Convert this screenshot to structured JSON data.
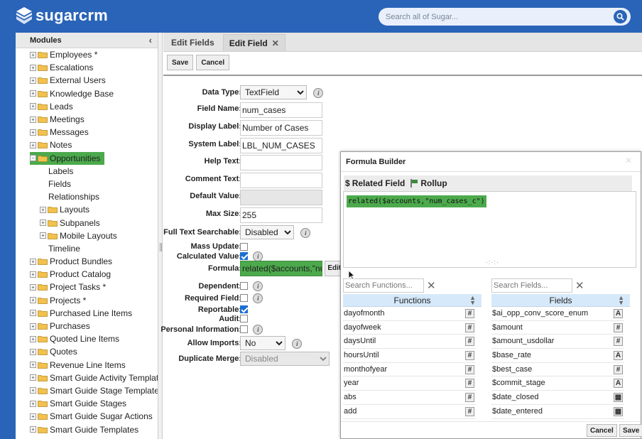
{
  "header": {
    "logo_text": "sugarcrm",
    "search_placeholder": "Search all of Sugar..."
  },
  "sidebar": {
    "title": "Modules",
    "items": [
      {
        "label": "Employees *",
        "level": 0,
        "expander": "+"
      },
      {
        "label": "Escalations",
        "level": 0,
        "expander": "+"
      },
      {
        "label": "External Users",
        "level": 0,
        "expander": "+"
      },
      {
        "label": "Knowledge Base",
        "level": 0,
        "expander": "+"
      },
      {
        "label": "Leads",
        "level": 0,
        "expander": "+"
      },
      {
        "label": "Meetings",
        "level": 0,
        "expander": "+"
      },
      {
        "label": "Messages",
        "level": 0,
        "expander": "+"
      },
      {
        "label": "Notes",
        "level": 0,
        "expander": "+"
      },
      {
        "label": "Opportunities",
        "level": 0,
        "expander": "−",
        "selected": true
      },
      {
        "label": "Labels",
        "level": 1
      },
      {
        "label": "Fields",
        "level": 1
      },
      {
        "label": "Relationships",
        "level": 1
      },
      {
        "label": "Layouts",
        "level": 1,
        "expander": "+",
        "folder": true
      },
      {
        "label": "Subpanels",
        "level": 1,
        "expander": "+",
        "folder": true
      },
      {
        "label": "Mobile Layouts",
        "level": 1,
        "expander": "+",
        "folder": true
      },
      {
        "label": "Timeline",
        "level": 1
      },
      {
        "label": "Product Bundles",
        "level": 0,
        "expander": "+"
      },
      {
        "label": "Product Catalog",
        "level": 0,
        "expander": "+"
      },
      {
        "label": "Project Tasks *",
        "level": 0,
        "expander": "+"
      },
      {
        "label": "Projects *",
        "level": 0,
        "expander": "+"
      },
      {
        "label": "Purchased Line Items",
        "level": 0,
        "expander": "+"
      },
      {
        "label": "Purchases",
        "level": 0,
        "expander": "+"
      },
      {
        "label": "Quoted Line Items",
        "level": 0,
        "expander": "+"
      },
      {
        "label": "Quotes",
        "level": 0,
        "expander": "+"
      },
      {
        "label": "Revenue Line Items",
        "level": 0,
        "expander": "+"
      },
      {
        "label": "Smart Guide Activity Templates",
        "level": 0,
        "expander": "+"
      },
      {
        "label": "Smart Guide Stage Templates",
        "level": 0,
        "expander": "+"
      },
      {
        "label": "Smart Guide Stages",
        "level": 0,
        "expander": "+"
      },
      {
        "label": "Smart Guide Sugar Actions",
        "level": 0,
        "expander": "+"
      },
      {
        "label": "Smart Guide Templates",
        "level": 0,
        "expander": "+"
      }
    ]
  },
  "tabs": {
    "edit_fields": "Edit Fields",
    "edit_field": "Edit Field",
    "close": "✕"
  },
  "toolbar": {
    "save": "Save",
    "cancel": "Cancel"
  },
  "form": {
    "data_type_label": "Data Type:",
    "data_type_value": "TextField",
    "field_name_label": "Field Name:",
    "field_name_value": "num_cases",
    "display_label_label": "Display Label:",
    "display_label_value": "Number of Cases",
    "system_label_label": "System Label:",
    "system_label_value": "LBL_NUM_CASES",
    "help_text_label": "Help Text:",
    "comment_text_label": "Comment Text:",
    "default_value_label": "Default Value:",
    "max_size_label": "Max Size:",
    "max_size_value": "255",
    "full_text_label": "Full Text Searchable:",
    "full_text_value": "Disabled",
    "mass_update_label": "Mass Update:",
    "calculated_label": "Calculated Value:",
    "formula_label": "Formula:",
    "formula_value": "related($accounts,\"num_cases_c\")",
    "edit_btn": "Edit",
    "dependent_label": "Dependent:",
    "required_label": "Required Field:",
    "reportable_label": "Reportable:",
    "audit_label": "Audit:",
    "personal_label": "Personal Information:",
    "allow_imports_label": "Allow Imports:",
    "allow_imports_value": "No",
    "duplicate_merge_label": "Duplicate Merge:",
    "duplicate_merge_value": "Disabled"
  },
  "formula_builder": {
    "title": "Formula Builder",
    "close": "✕",
    "related_field": "Related Field",
    "rollup": "Rollup",
    "formula": "related($accounts,\"num_cases_c\")",
    "resize_dots": "·:·:·",
    "search_functions_placeholder": "Search Functions...",
    "search_fields_placeholder": "Search Fields...",
    "functions_header": "Functions",
    "fields_header": "Fields",
    "functions": [
      {
        "name": "dayofmonth",
        "type": "#"
      },
      {
        "name": "dayofweek",
        "type": "#"
      },
      {
        "name": "daysUntil",
        "type": "#"
      },
      {
        "name": "hoursUntil",
        "type": "#"
      },
      {
        "name": "monthofyear",
        "type": "#"
      },
      {
        "name": "year",
        "type": "#"
      },
      {
        "name": "abs",
        "type": "#"
      },
      {
        "name": "add",
        "type": "#"
      }
    ],
    "fields": [
      {
        "name": "$ai_opp_conv_score_enum",
        "type": "A"
      },
      {
        "name": "$amount",
        "type": "#"
      },
      {
        "name": "$amount_usdollar",
        "type": "#"
      },
      {
        "name": "$base_rate",
        "type": "A"
      },
      {
        "name": "$best_case",
        "type": "#"
      },
      {
        "name": "$commit_stage",
        "type": "A"
      },
      {
        "name": "$date_closed",
        "type": "▦"
      },
      {
        "name": "$date_entered",
        "type": "▦"
      }
    ],
    "cancel": "Cancel",
    "save": "Save"
  }
}
